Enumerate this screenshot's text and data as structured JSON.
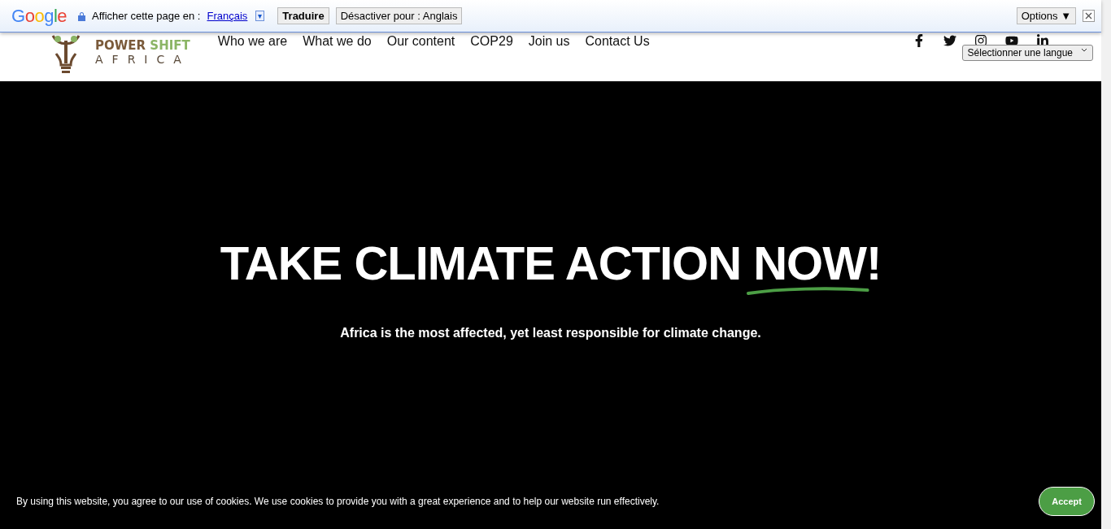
{
  "translate_bar": {
    "logo": "Google",
    "prompt": "Afficher cette page en :",
    "language": "Français",
    "dropdown_arrow": "▾",
    "translate_button": "Traduire",
    "disable_button": "Désactiver pour : Anglais",
    "options_button": "Options ▼"
  },
  "header": {
    "logo": {
      "line_1_a": "POWER",
      "line_1_b": "SHIFT",
      "line_2": "AFRICA"
    },
    "nav": [
      {
        "label": "Who we are"
      },
      {
        "label": "What we do"
      },
      {
        "label": "Our content"
      },
      {
        "label": "COP29"
      },
      {
        "label": "Join us"
      },
      {
        "label": "Contact Us"
      }
    ],
    "social": [
      {
        "kind": "facebook"
      },
      {
        "kind": "twitter"
      },
      {
        "kind": "instagram"
      },
      {
        "kind": "youtube"
      },
      {
        "kind": "linkedin"
      }
    ],
    "language_select": "Sélectionner une langue"
  },
  "hero": {
    "title_before": "TAKE CLIMATE ACTION ",
    "title_highlight": "NOW",
    "title_after": "!",
    "subtitle": "Africa is the most affected, yet least responsible for climate change."
  },
  "cookie_bar": {
    "text": "By using this website, you agree to our use of cookies. We use cookies to provide you with a great experience and to help our website run effectively.",
    "button": "Accept"
  }
}
